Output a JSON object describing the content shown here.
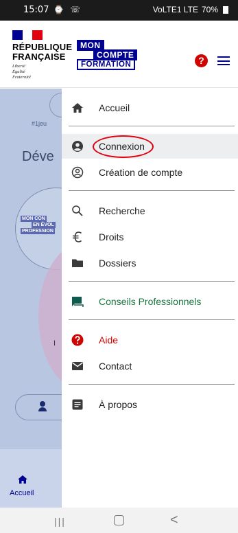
{
  "status_bar": {
    "time": "15:07",
    "left_icons": "⌚ ☏",
    "network": "VoLTE1 LTE",
    "battery": "70%"
  },
  "header": {
    "rf_title_line1": "RÉPUBLIQUE",
    "rf_title_line2": "FRANÇAISE",
    "rf_motto_line1": "Liberté",
    "rf_motto_line2": "Égalité",
    "rf_motto_line3": "Fraternité",
    "logo_line1": "MON",
    "logo_line2": "COMPTE",
    "logo_line3": "FORMATION",
    "help_icon_glyph": "?"
  },
  "background_page": {
    "hashtag": "#1jeu",
    "heading": "Déve",
    "logo_line1": "MON CON",
    "logo_line2": "EN ÉVOL",
    "logo_line3": "PROFESSION",
    "small_letter": "I"
  },
  "bottom_nav": {
    "home_label": "Accueil"
  },
  "drawer": {
    "items": [
      {
        "label": "Accueil",
        "icon": "home-icon"
      },
      {
        "label": "Connexion",
        "icon": "account-circle-icon"
      },
      {
        "label": "Création de compte",
        "icon": "account-outline-icon"
      },
      {
        "label": "Recherche",
        "icon": "search-icon"
      },
      {
        "label": "Droits",
        "icon": "euro-icon"
      },
      {
        "label": "Dossiers",
        "icon": "folder-icon"
      },
      {
        "label": "Conseils Professionnels",
        "icon": "chat-icon"
      },
      {
        "label": "Aide",
        "icon": "help-icon"
      },
      {
        "label": "Contact",
        "icon": "mail-icon"
      },
      {
        "label": "À propos",
        "icon": "info-document-icon"
      }
    ],
    "active_item": "Connexion"
  },
  "colors": {
    "brand_blue": "#000091",
    "help_red": "#ce0500",
    "advice_green": "#18753c",
    "annotation_red": "#e1000f"
  },
  "system_nav": {
    "recent": "|||",
    "back": "<"
  }
}
